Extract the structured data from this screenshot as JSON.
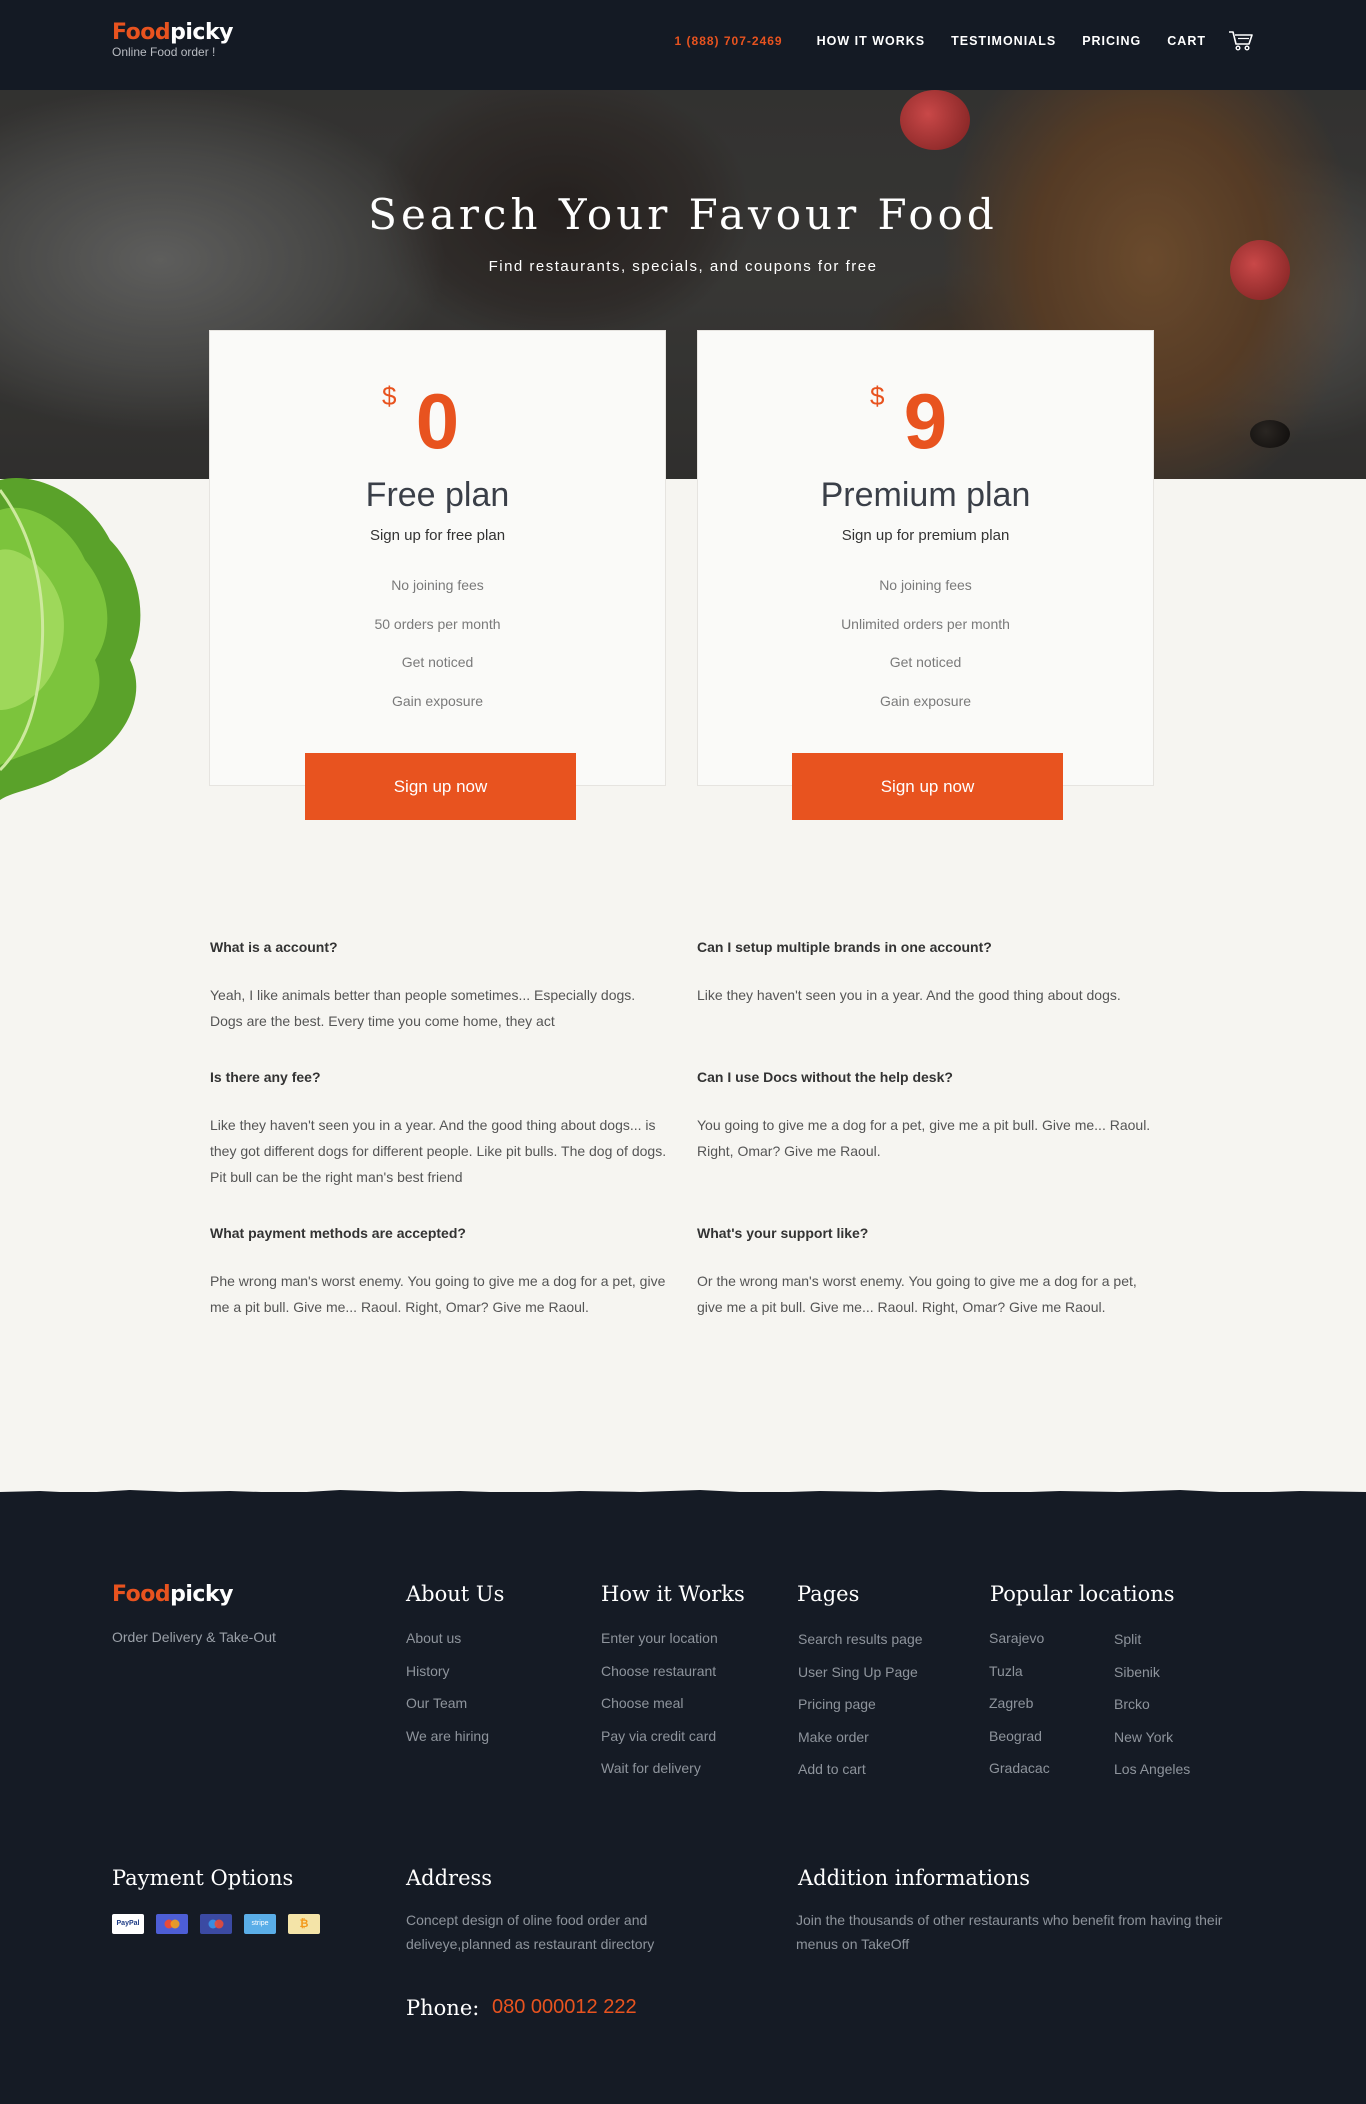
{
  "header": {
    "logo_food": "Food",
    "logo_picky": "picky",
    "tagline": "Online Food order !",
    "phone": "1 (888) 707-2469",
    "nav": [
      "HOW IT WORKS",
      "TESTIMONIALS",
      "PRICING",
      "CART"
    ],
    "cart_icon": "cart-icon"
  },
  "hero": {
    "title": "Search Your Favour Food",
    "subtitle": "Find restaurants, specials, and coupons for free"
  },
  "plans": [
    {
      "currency": "$",
      "price": "0",
      "name": "Free plan",
      "subtitle": "Sign up for free plan",
      "features": [
        "No joining fees",
        "50 orders per month",
        "Get noticed",
        "Gain exposure"
      ],
      "button": "Sign up now"
    },
    {
      "currency": "$",
      "price": "9",
      "name": "Premium plan",
      "subtitle": "Sign up for premium plan",
      "features": [
        "No joining fees",
        "Unlimited orders per month",
        "Get noticed",
        "Gain exposure"
      ],
      "button": "Sign up now"
    }
  ],
  "faq": {
    "left": [
      {
        "q": "What is a account?",
        "a": "Yeah, I like animals better than people sometimes... Especially dogs. Dogs are the best. Every time you come home, they act"
      },
      {
        "q": "Is there any fee?",
        "a": "Like they haven't seen you in a year. And the good thing about dogs... is they got different dogs for different people. Like pit bulls. The dog of dogs. Pit bull can be the right man's best friend"
      },
      {
        "q": "What payment methods are accepted?",
        "a": "Phe wrong man's worst enemy. You going to give me a dog for a pet, give me a pit bull. Give me... Raoul. Right, Omar? Give me Raoul."
      }
    ],
    "right": [
      {
        "q": "Can I setup multiple brands in one account?",
        "a": "Like they haven't seen you in a year. And the good thing about dogs."
      },
      {
        "q": "Can I use Docs without the help desk?",
        "a": "You going to give me a dog for a pet, give me a pit bull. Give me... Raoul. Right, Omar? Give me Raoul."
      },
      {
        "q": "What's your support like?",
        "a": "Or the wrong man's worst enemy. You going to give me a dog for a pet, give me a pit bull. Give me... Raoul. Right, Omar? Give me Raoul."
      }
    ]
  },
  "footer": {
    "logo_food": "Food",
    "logo_picky": "picky",
    "tagline": "Order Delivery & Take-Out",
    "about": {
      "title": "About Us",
      "items": [
        "About us",
        "History",
        "Our Team",
        "We are hiring"
      ]
    },
    "how": {
      "title": "How it Works",
      "items": [
        "Enter your location",
        "Choose restaurant",
        "Choose meal",
        "Pay via credit card",
        "Wait for delivery"
      ]
    },
    "pages": {
      "title": "Pages",
      "items": [
        "Search results page",
        "User Sing Up Page",
        "Pricing page",
        "Make order",
        "Add to cart"
      ]
    },
    "locations": {
      "title": "Popular locations",
      "col1": [
        "Sarajevo",
        "Tuzla",
        "Zagreb",
        "Beograd",
        "Gradacac"
      ],
      "col2": [
        "Split",
        "Sibenik",
        "Brcko",
        "New York",
        "Los Angeles"
      ]
    },
    "payment": {
      "title": "Payment Options",
      "icons": [
        "PayPal",
        "",
        "",
        "stripe",
        "₿"
      ]
    },
    "address": {
      "title": "Address",
      "text": "Concept design of oline food order and deliveye,planned as restaurant directory"
    },
    "phone": {
      "label": "Phone:",
      "value": "080 000012 222"
    },
    "addition": {
      "title": "Addition informations",
      "text": "Join the thousands of other restaurants who benefit from having their menus on TakeOff"
    }
  },
  "colors": {
    "accent": "#e8531f",
    "dark": "#151b25"
  }
}
